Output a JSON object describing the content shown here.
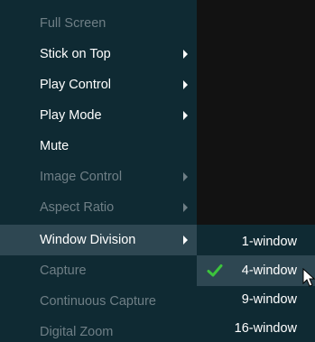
{
  "context_menu": {
    "items": [
      {
        "label": "Full Screen",
        "enabled": false,
        "has_submenu": false
      },
      {
        "label": "Stick on Top",
        "enabled": true,
        "has_submenu": true
      },
      {
        "label": "Play Control",
        "enabled": true,
        "has_submenu": true
      },
      {
        "label": "Play Mode",
        "enabled": true,
        "has_submenu": true
      },
      {
        "label": "Mute",
        "enabled": true,
        "has_submenu": false
      },
      {
        "label": "Image Control",
        "enabled": false,
        "has_submenu": true
      },
      {
        "label": "Aspect Ratio",
        "enabled": false,
        "has_submenu": true
      },
      {
        "label": "Window Division",
        "enabled": true,
        "has_submenu": true,
        "highlighted": true
      },
      {
        "label": "Capture",
        "enabled": false,
        "has_submenu": false
      },
      {
        "label": "Continuous Capture",
        "enabled": false,
        "has_submenu": false
      },
      {
        "label": "Digital Zoom",
        "enabled": false,
        "has_submenu": false
      }
    ]
  },
  "window_division_submenu": {
    "items": [
      {
        "label": "1-window",
        "checked": false
      },
      {
        "label": "4-window",
        "checked": true
      },
      {
        "label": "9-window",
        "checked": false
      },
      {
        "label": "16-window",
        "checked": false
      }
    ]
  },
  "colors": {
    "menu_background": "#0f2a33",
    "highlight_background": "#2e4752",
    "enabled_text": "#ffffff",
    "disabled_text": "#6f7f86",
    "check_mark": "#3cc43c",
    "video_area": "#121212"
  },
  "icons": {
    "submenu_arrow": "triangle-right-icon",
    "check": "check-icon",
    "cursor": "mouse-pointer-icon"
  }
}
